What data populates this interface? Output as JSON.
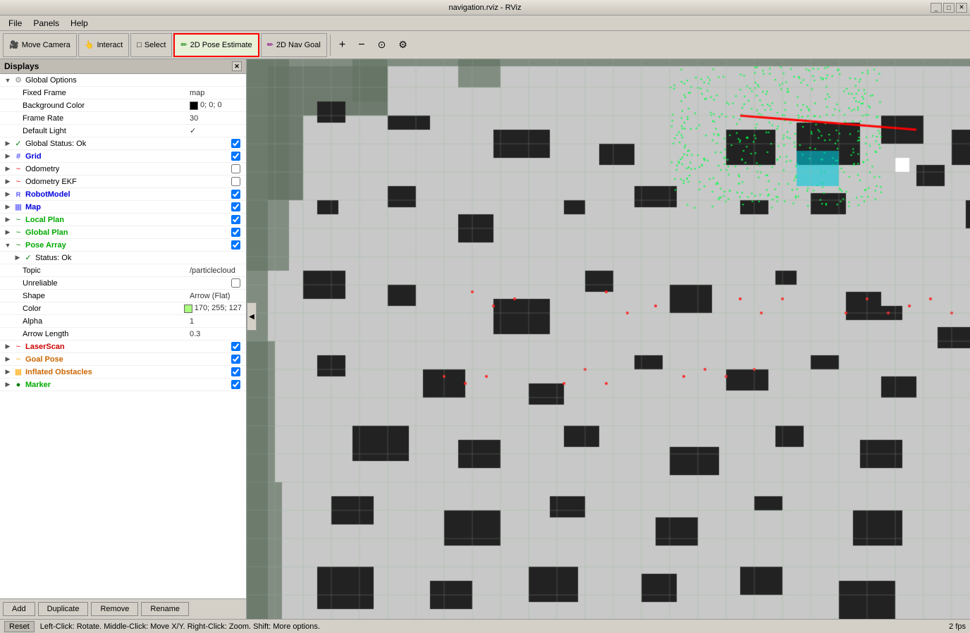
{
  "window": {
    "title": "navigation.rviz - RViz",
    "controls": [
      "minimize",
      "maximize",
      "close"
    ]
  },
  "menubar": {
    "items": [
      "File",
      "Panels",
      "Help"
    ]
  },
  "toolbar": {
    "buttons": [
      {
        "id": "move-camera",
        "icon": "🎥",
        "label": "Move Camera",
        "highlighted": false
      },
      {
        "id": "interact",
        "icon": "👆",
        "label": "Interact",
        "highlighted": false
      },
      {
        "id": "select",
        "icon": "□",
        "label": "Select",
        "highlighted": false
      },
      {
        "id": "pose-estimate",
        "icon": "✏",
        "label": "2D Pose Estimate",
        "highlighted": true
      },
      {
        "id": "nav-goal",
        "icon": "✏",
        "label": "2D Nav Goal",
        "highlighted": false
      }
    ],
    "extra": [
      "+",
      "−",
      "⊙",
      "⚙"
    ]
  },
  "displays": {
    "header": "Displays",
    "items": [
      {
        "id": "global-options",
        "label": "Global Options",
        "type": "group",
        "level": 0,
        "expanded": true,
        "icon": "▼",
        "color": "normal",
        "children": [
          {
            "id": "fixed-frame",
            "label": "Fixed Frame",
            "value": "map",
            "level": 1,
            "type": "property"
          },
          {
            "id": "background-color",
            "label": "Background Color",
            "value": "0; 0; 0",
            "swatch": "#000000",
            "level": 1,
            "type": "property"
          },
          {
            "id": "frame-rate",
            "label": "Frame Rate",
            "value": "30",
            "level": 1,
            "type": "property"
          },
          {
            "id": "default-light",
            "label": "Default Light",
            "value": "✓",
            "level": 1,
            "type": "property"
          }
        ]
      },
      {
        "id": "global-status",
        "label": "Global Status: Ok",
        "level": 0,
        "icon": "✓",
        "iconColor": "green",
        "type": "item",
        "checked": true
      },
      {
        "id": "grid",
        "label": "Grid",
        "level": 0,
        "icon": "#",
        "iconColor": "blue",
        "type": "item",
        "checked": true,
        "hasCheck": true
      },
      {
        "id": "odometry",
        "label": "Odometry",
        "level": 0,
        "icon": "~",
        "iconColor": "red",
        "type": "item",
        "checked": false,
        "hasCheck": true
      },
      {
        "id": "odometry-ekf",
        "label": "Odometry EKF",
        "level": 0,
        "icon": "~",
        "iconColor": "red",
        "type": "item",
        "checked": false,
        "hasCheck": true
      },
      {
        "id": "robot-model",
        "label": "RobotModel",
        "level": 0,
        "icon": "R",
        "iconColor": "blue",
        "type": "item",
        "checked": true,
        "hasCheck": true
      },
      {
        "id": "map",
        "label": "Map",
        "level": 0,
        "icon": "▦",
        "iconColor": "blue",
        "type": "item",
        "checked": true,
        "hasCheck": true
      },
      {
        "id": "local-plan",
        "label": "Local Plan",
        "level": 0,
        "icon": "~",
        "iconColor": "green",
        "type": "item",
        "checked": true,
        "hasCheck": true
      },
      {
        "id": "global-plan",
        "label": "Global Plan",
        "level": 0,
        "icon": "~",
        "iconColor": "green",
        "type": "item",
        "checked": true,
        "hasCheck": true
      },
      {
        "id": "pose-array",
        "label": "Pose Array",
        "level": 0,
        "icon": "~",
        "iconColor": "green",
        "type": "group",
        "expanded": true,
        "checked": true,
        "hasCheck": true,
        "children": [
          {
            "id": "pose-status",
            "label": "Status: Ok",
            "level": 1,
            "icon": "✓",
            "iconColor": "green",
            "type": "item"
          },
          {
            "id": "topic",
            "label": "Topic",
            "value": "/particlecloud",
            "level": 1,
            "type": "property"
          },
          {
            "id": "unreliable",
            "label": "Unreliable",
            "value": "",
            "level": 1,
            "type": "property",
            "checkbox": true,
            "checked": false
          },
          {
            "id": "shape",
            "label": "Shape",
            "value": "Arrow (Flat)",
            "level": 1,
            "type": "property"
          },
          {
            "id": "color",
            "label": "Color",
            "value": "170; 255; 127",
            "swatch": "#aAff7f",
            "level": 1,
            "type": "property"
          },
          {
            "id": "alpha",
            "label": "Alpha",
            "value": "1",
            "level": 1,
            "type": "property"
          },
          {
            "id": "arrow-length",
            "label": "Arrow Length",
            "value": "0.3",
            "level": 1,
            "type": "property"
          }
        ]
      },
      {
        "id": "laser-scan",
        "label": "LaserScan",
        "level": 0,
        "icon": "~",
        "iconColor": "red",
        "type": "item",
        "checked": true,
        "hasCheck": true
      },
      {
        "id": "goal-pose",
        "label": "Goal Pose",
        "level": 0,
        "icon": "~",
        "iconColor": "orange",
        "type": "item",
        "checked": true,
        "hasCheck": true
      },
      {
        "id": "inflated-obstacles",
        "label": "Inflated Obstacles",
        "level": 0,
        "icon": "▦",
        "iconColor": "orange",
        "type": "item",
        "checked": true,
        "hasCheck": true
      },
      {
        "id": "marker",
        "label": "Marker",
        "level": 0,
        "icon": "●",
        "iconColor": "green",
        "type": "item",
        "checked": true,
        "hasCheck": true
      }
    ]
  },
  "bottom_buttons": [
    "Add",
    "Duplicate",
    "Remove",
    "Rename"
  ],
  "statusbar": {
    "reset_label": "Reset",
    "instructions": "Left-Click: Rotate. Middle-Click: Move X/Y. Right-Click: Zoom. Shift: More options.",
    "fps": "2 fps"
  }
}
